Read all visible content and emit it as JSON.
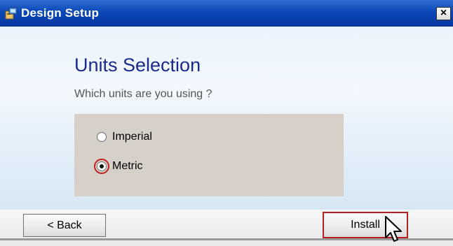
{
  "window": {
    "title": "Design Setup",
    "close_glyph": "×"
  },
  "page": {
    "heading": "Units Selection",
    "question": "Which units are you using ?"
  },
  "options": [
    {
      "label": "Imperial",
      "selected": false
    },
    {
      "label": "Metric",
      "selected": true
    }
  ],
  "buttons": {
    "back": "< Back",
    "install": "Install"
  },
  "icons": {
    "app": "setup-app-icon",
    "cursor": "mouse-pointer-icon",
    "close": "close-icon"
  },
  "colors": {
    "titlebar": "#0b47b8",
    "heading": "#1b2a8f",
    "highlight": "#c02020",
    "options_panel": "#d6d0c9"
  }
}
